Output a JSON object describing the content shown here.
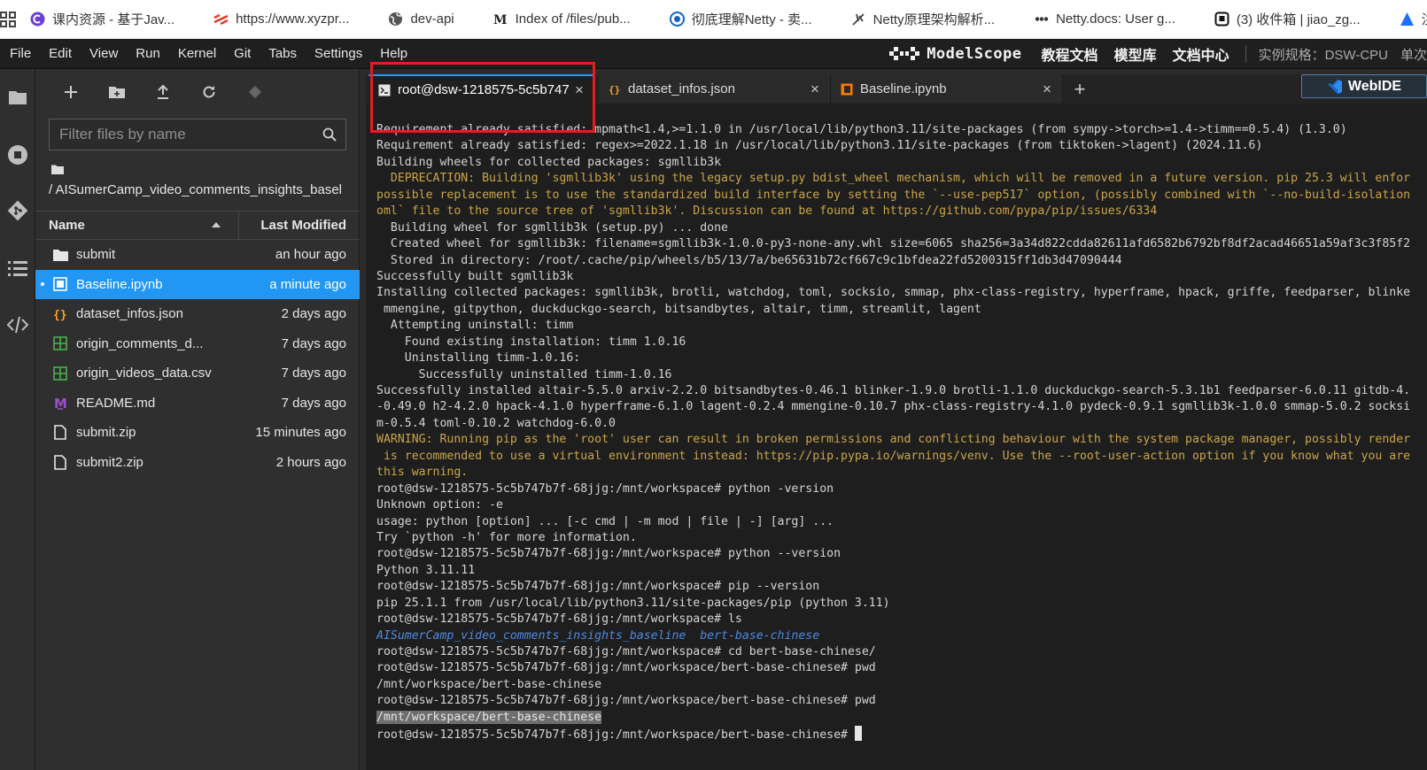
{
  "bookmarks": [
    {
      "label": "课内资源 - 基于Jav...",
      "icon": "purple-c-icon",
      "color": "#6a3fd6"
    },
    {
      "label": "https://www.xyzpr...",
      "icon": "red-stripes-icon",
      "color": "#e33b2e"
    },
    {
      "label": "dev-api",
      "icon": "globe-icon",
      "color": "#555555"
    },
    {
      "label": "Index of /files/pub...",
      "icon": "mii-icon",
      "color": "#222222"
    },
    {
      "label": "彻底理解Netty - 卖...",
      "icon": "circle-blue-icon",
      "color": "#1565c0"
    },
    {
      "label": "Netty原理架构解析...",
      "icon": "feather-icon",
      "color": "#444444"
    },
    {
      "label": "Netty.docs: User g...",
      "icon": "dots-icon",
      "color": "#333333"
    },
    {
      "label": "(3) 收件箱 | jiao_zg...",
      "icon": "inbox-icon",
      "color": "#111111"
    },
    {
      "label": "注册 - 使",
      "icon": "triangle-icon",
      "color": "#1e6fff"
    }
  ],
  "menu": [
    "File",
    "Edit",
    "View",
    "Run",
    "Kernel",
    "Git",
    "Tabs",
    "Settings",
    "Help"
  ],
  "header": {
    "logo_text": "ModelScope",
    "links": [
      "教程文档",
      "模型库",
      "文档中心"
    ],
    "spec": "实例规格：DSW-CPU",
    "extra": "单次"
  },
  "filebrowser": {
    "filter_placeholder": "Filter files by name",
    "path": "/ AISumerCamp_video_comments_insights_basel",
    "col_name": "Name",
    "col_modified": "Last Modified",
    "files": [
      {
        "name": "submit",
        "modified": "an hour ago",
        "type": "folder-icon",
        "color": "#e6e6e6",
        "selected": false
      },
      {
        "name": "Baseline.ipynb",
        "modified": "a minute ago",
        "type": "notebook-icon",
        "color": "#ffffff",
        "selected": true
      },
      {
        "name": "dataset_infos.json",
        "modified": "2 days ago",
        "type": "json-icon",
        "color": "#f5a623",
        "selected": false
      },
      {
        "name": "origin_comments_d...",
        "modified": "7 days ago",
        "type": "table-icon",
        "color": "#4caf50",
        "selected": false
      },
      {
        "name": "origin_videos_data.csv",
        "modified": "7 days ago",
        "type": "table-icon",
        "color": "#4caf50",
        "selected": false
      },
      {
        "name": "README.md",
        "modified": "7 days ago",
        "type": "markdown-icon",
        "color": "#9c4dcc",
        "selected": false
      },
      {
        "name": "submit.zip",
        "modified": "15 minutes ago",
        "type": "file-icon",
        "color": "#e6e6e6",
        "selected": false
      },
      {
        "name": "submit2.zip",
        "modified": "2 hours ago",
        "type": "file-icon",
        "color": "#e6e6e6",
        "selected": false
      }
    ]
  },
  "tabs": [
    {
      "label": "root@dsw-1218575-5c5b747",
      "icon": "terminal-icon",
      "active": true
    },
    {
      "label": "dataset_infos.json",
      "icon": "json-icon",
      "active": false
    },
    {
      "label": "Baseline.ipynb",
      "icon": "notebook-icon",
      "active": false
    }
  ],
  "webide_label": "WebIDE",
  "terminal": {
    "lines": [
      {
        "t": "Requirement already satisfied: mpmath<1.4,>=1.1.0 in /usr/local/lib/python3.11/site-packages (from sympy->torch>=1.4->timm==0.5.4) (1.3.0)",
        "k": "n"
      },
      {
        "t": "Requirement already satisfied: regex>=2022.1.18 in /usr/local/lib/python3.11/site-packages (from tiktoken->lagent) (2024.11.6)",
        "k": "n"
      },
      {
        "t": "Building wheels for collected packages: sgmllib3k",
        "k": "n"
      },
      {
        "t": "  DEPRECATION: Building 'sgmllib3k' using the legacy setup.py bdist_wheel mechanism, which will be removed in a future version. pip 25.3 will enfor",
        "k": "w"
      },
      {
        "t": "possible replacement is to use the standardized build interface by setting the `--use-pep517` option, (possibly combined with `--no-build-isolation",
        "k": "w"
      },
      {
        "t": "oml` file to the source tree of 'sgmllib3k'. Discussion can be found at https://github.com/pypa/pip/issues/6334",
        "k": "w"
      },
      {
        "t": "  Building wheel for sgmllib3k (setup.py) ... done",
        "k": "n"
      },
      {
        "t": "  Created wheel for sgmllib3k: filename=sgmllib3k-1.0.0-py3-none-any.whl size=6065 sha256=3a34d822cdda82611afd6582b6792bf8df2acad46651a59af3c3f85f2",
        "k": "n"
      },
      {
        "t": "  Stored in directory: /root/.cache/pip/wheels/b5/13/7a/be65631b72cf667c9c1bfdea22fd5200315ff1db3d47090444",
        "k": "n"
      },
      {
        "t": "Successfully built sgmllib3k",
        "k": "n"
      },
      {
        "t": "Installing collected packages: sgmllib3k, brotli, watchdog, toml, socksio, smmap, phx-class-registry, hyperframe, hpack, griffe, feedparser, blinke",
        "k": "n"
      },
      {
        "t": " mmengine, gitpython, duckduckgo-search, bitsandbytes, altair, timm, streamlit, lagent",
        "k": "n"
      },
      {
        "t": "  Attempting uninstall: timm",
        "k": "n"
      },
      {
        "t": "    Found existing installation: timm 1.0.16",
        "k": "n"
      },
      {
        "t": "    Uninstalling timm-1.0.16:",
        "k": "n"
      },
      {
        "t": "      Successfully uninstalled timm-1.0.16",
        "k": "n"
      },
      {
        "t": "Successfully installed altair-5.5.0 arxiv-2.2.0 bitsandbytes-0.46.1 blinker-1.9.0 brotli-1.1.0 duckduckgo-search-5.3.1b1 feedparser-6.0.11 gitdb-4.",
        "k": "n"
      },
      {
        "t": "-0.49.0 h2-4.2.0 hpack-4.1.0 hyperframe-6.1.0 lagent-0.2.4 mmengine-0.10.7 phx-class-registry-4.1.0 pydeck-0.9.1 sgmllib3k-1.0.0 smmap-5.0.2 socksi",
        "k": "n"
      },
      {
        "t": "m-0.5.4 toml-0.10.2 watchdog-6.0.0",
        "k": "n"
      },
      {
        "t": "WARNING: Running pip as the 'root' user can result in broken permissions and conflicting behaviour with the system package manager, possibly render",
        "k": "w"
      },
      {
        "t": " is recommended to use a virtual environment instead: https://pip.pypa.io/warnings/venv. Use the --root-user-action option if you know what you are",
        "k": "w"
      },
      {
        "t": "this warning.",
        "k": "w"
      },
      {
        "t": "root@dsw-1218575-5c5b747b7f-68jjg:/mnt/workspace# python -version",
        "k": "n"
      },
      {
        "t": "Unknown option: -e",
        "k": "n"
      },
      {
        "t": "usage: python [option] ... [-c cmd | -m mod | file | -] [arg] ...",
        "k": "n"
      },
      {
        "t": "Try `python -h' for more information.",
        "k": "n"
      },
      {
        "t": "root@dsw-1218575-5c5b747b7f-68jjg:/mnt/workspace# python --version",
        "k": "n"
      },
      {
        "t": "Python 3.11.11",
        "k": "n"
      },
      {
        "t": "root@dsw-1218575-5c5b747b7f-68jjg:/mnt/workspace# pip --version",
        "k": "n"
      },
      {
        "t": "pip 25.1.1 from /usr/local/lib/python3.11/site-packages/pip (python 3.11)",
        "k": "n"
      },
      {
        "t": "root@dsw-1218575-5c5b747b7f-68jjg:/mnt/workspace# ls",
        "k": "n"
      },
      {
        "t": "AISumerCamp_video_comments_insights_baseline  bert-base-chinese",
        "k": "d"
      },
      {
        "t": "root@dsw-1218575-5c5b747b7f-68jjg:/mnt/workspace# cd bert-base-chinese/",
        "k": "n"
      },
      {
        "t": "root@dsw-1218575-5c5b747b7f-68jjg:/mnt/workspace/bert-base-chinese# pwd",
        "k": "n"
      },
      {
        "t": "/mnt/workspace/bert-base-chinese",
        "k": "n"
      },
      {
        "t": "root@dsw-1218575-5c5b747b7f-68jjg:/mnt/workspace/bert-base-chinese# pwd",
        "k": "n"
      },
      {
        "t": "/mnt/workspace/bert-base-chinese",
        "k": "s"
      },
      {
        "t": "root@dsw-1218575-5c5b747b7f-68jjg:/mnt/workspace/bert-base-chinese# ",
        "k": "c"
      }
    ]
  }
}
